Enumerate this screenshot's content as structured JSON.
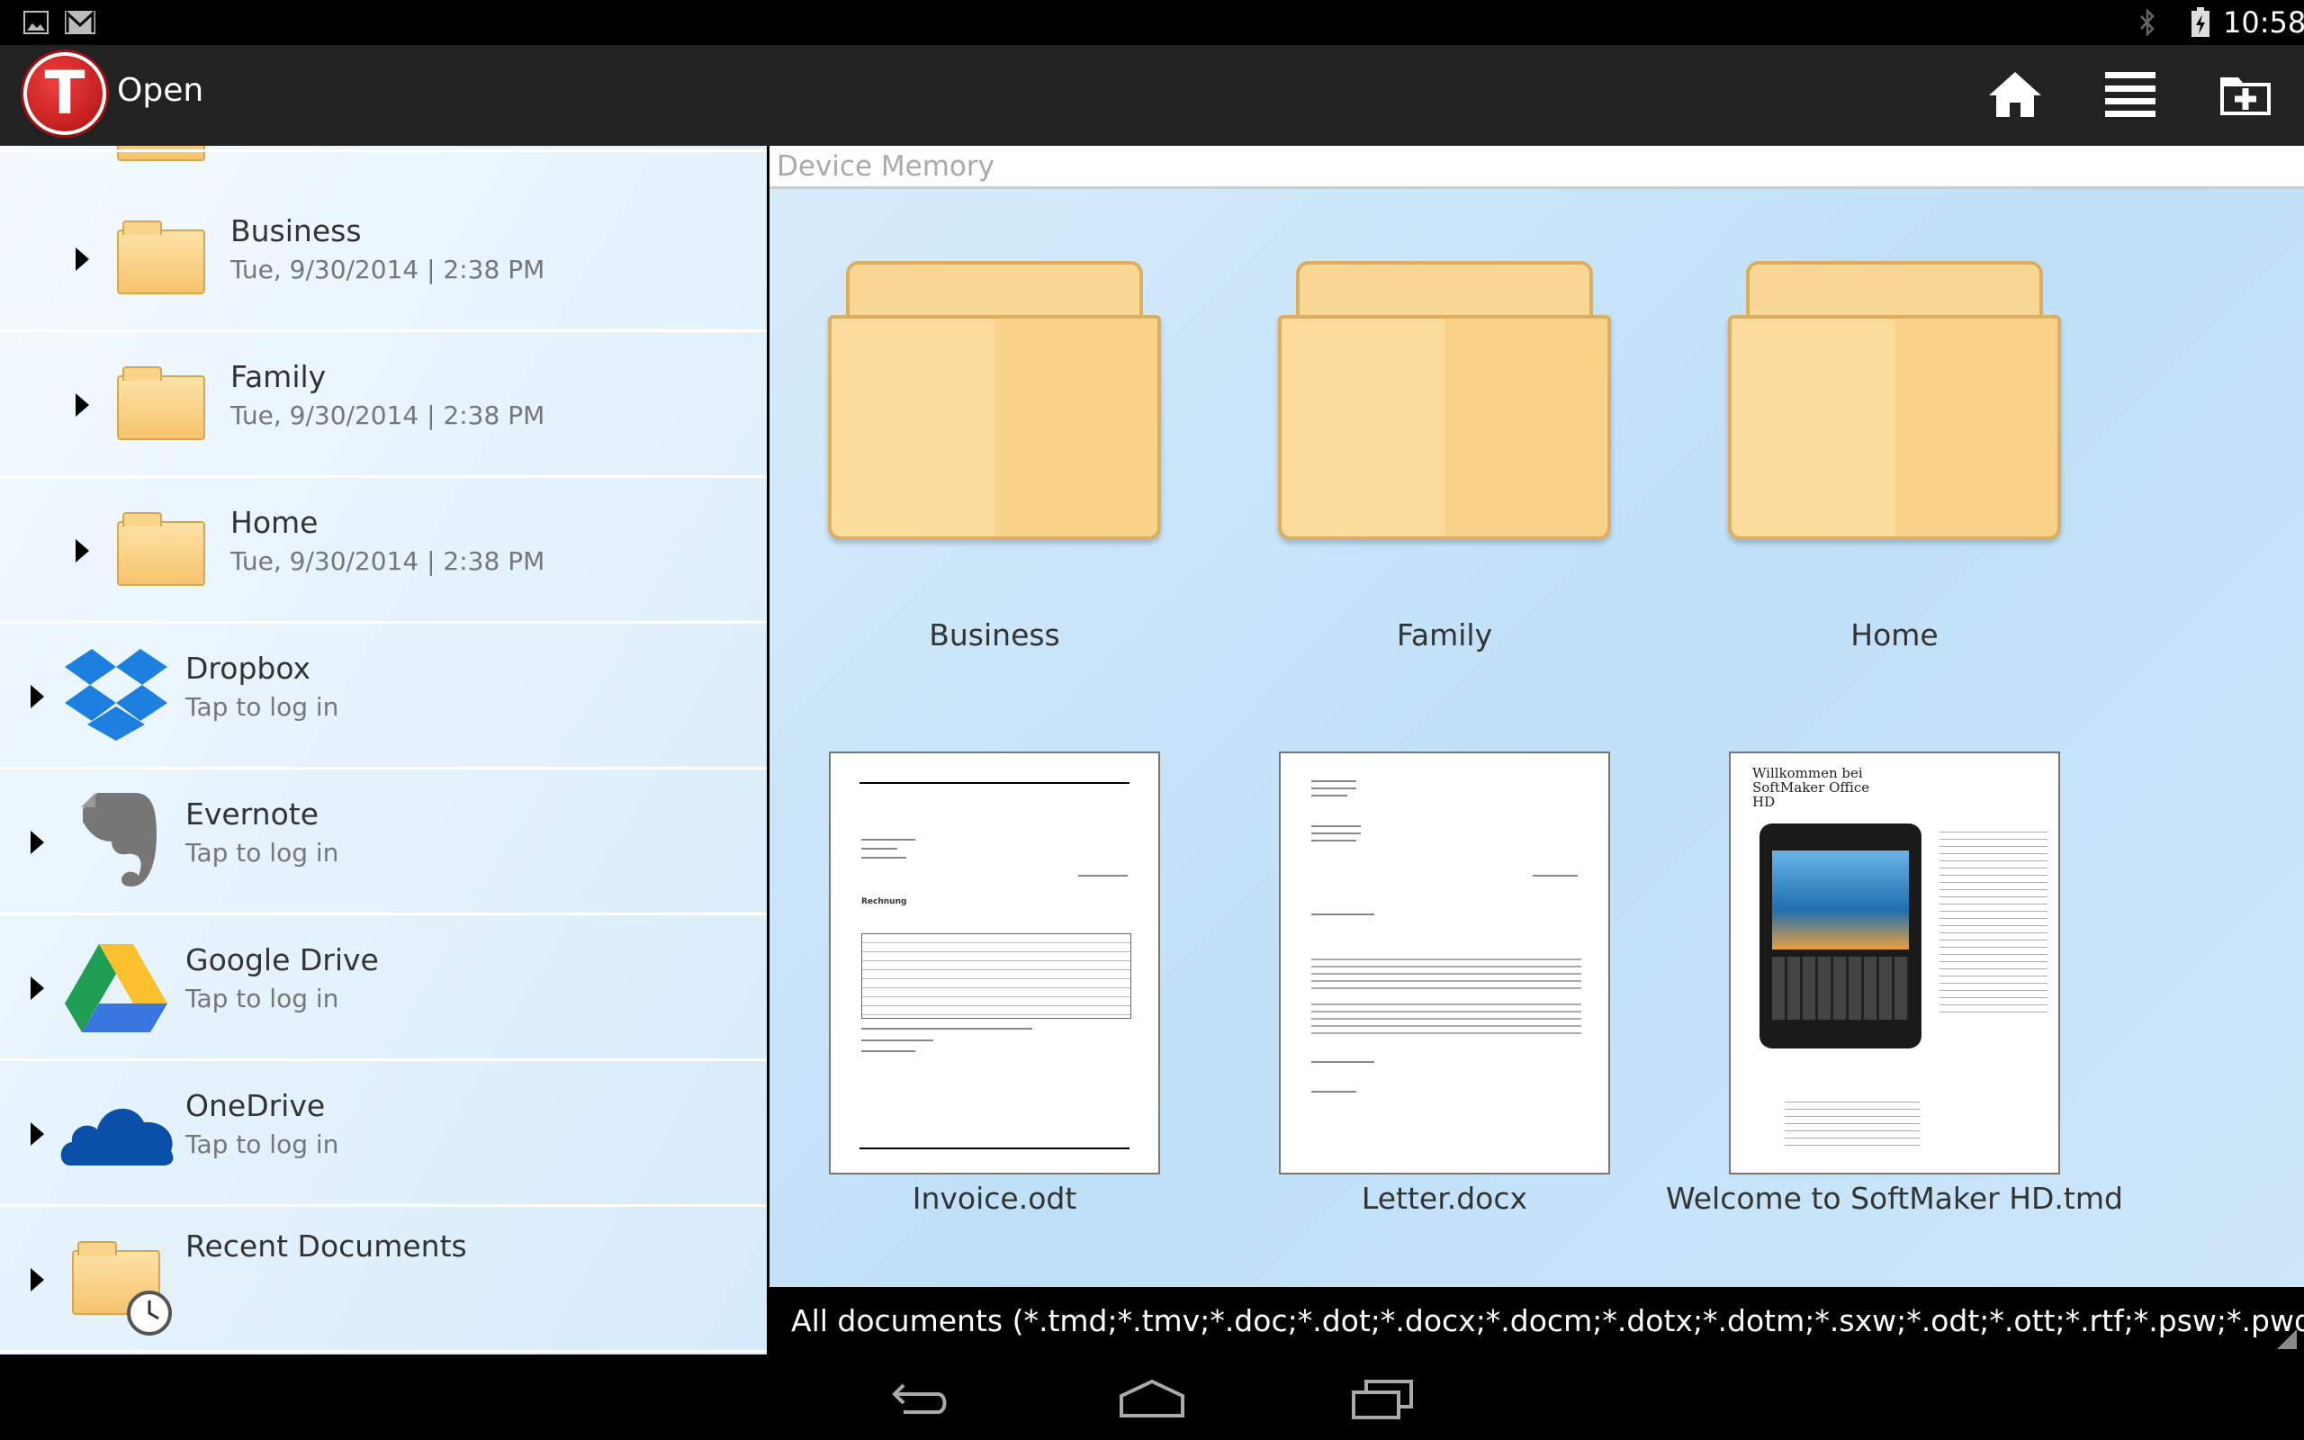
{
  "status": {
    "time": "10:58",
    "left_icons": [
      "image-icon",
      "gmail-icon"
    ],
    "right_icons": [
      "bluetooth-icon",
      "battery-charging-icon"
    ]
  },
  "actionbar": {
    "logo": "T",
    "title": "Open",
    "buttons": [
      "home-icon",
      "list-icon",
      "new-folder-icon"
    ]
  },
  "sidebar": {
    "items": [
      {
        "title": "Business",
        "subtitle": "Tue, 9/30/2014 | 2:38 PM",
        "icon": "folder-icon"
      },
      {
        "title": "Family",
        "subtitle": "Tue, 9/30/2014 | 2:38 PM",
        "icon": "folder-icon"
      },
      {
        "title": "Home",
        "subtitle": "Tue, 9/30/2014 | 2:38 PM",
        "icon": "folder-icon"
      },
      {
        "title": "Dropbox",
        "subtitle": "Tap to log in",
        "icon": "dropbox-icon"
      },
      {
        "title": "Evernote",
        "subtitle": "Tap to log in",
        "icon": "evernote-icon"
      },
      {
        "title": "Google Drive",
        "subtitle": "Tap to log in",
        "icon": "google-drive-icon"
      },
      {
        "title": "OneDrive",
        "subtitle": "Tap to log in",
        "icon": "onedrive-icon"
      },
      {
        "title": "Recent Documents",
        "subtitle": "",
        "icon": "recent-documents-icon"
      }
    ]
  },
  "main": {
    "location": "Device Memory",
    "folders": [
      "Business",
      "Family",
      "Home"
    ],
    "files": [
      "Invoice.odt",
      "Letter.docx",
      "Welcome to SoftMaker HD.tmd"
    ],
    "thumb_texts": {
      "invoice_heading": "Rechnung",
      "welcome_title": "Willkommen bei SoftMaker Office HD"
    },
    "filter": "All documents (*.tmd;*.tmv;*.doc;*.dot;*.docx;*.docm;*.dotx;*.dotm;*.sxw;*.odt;*.ott;*.rtf;*.psw;*.pwd;*.htm;*.html;.."
  },
  "navbar": {
    "buttons": [
      "back-icon",
      "home-icon",
      "recent-apps-icon"
    ]
  }
}
